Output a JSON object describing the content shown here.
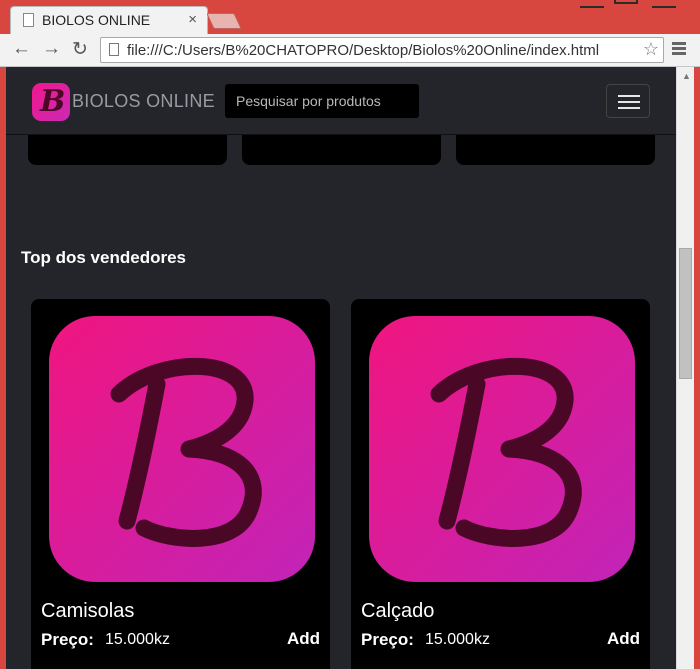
{
  "browser": {
    "tab_title": "BIOLOS ONLINE",
    "tab_close": "×",
    "url": "file:///C:/Users/B%20CHATOPRO/Desktop/Biolos%20Online/index.html",
    "icons": {
      "back": "←",
      "forward": "→",
      "reload": "↻",
      "star": "☆",
      "scroll_up": "▲"
    }
  },
  "navbar": {
    "logo_letter": "B",
    "brand": "BIOLOS ONLINE",
    "search_placeholder": "Pesquisar por produtos"
  },
  "section": {
    "title": "Top dos vendedores"
  },
  "products": [
    {
      "name": "Camisolas",
      "price_label": "Preço:",
      "price": "15.000kz",
      "add_label": "Add"
    },
    {
      "name": "Calçado",
      "price_label": "Preço:",
      "price": "15.000kz",
      "add_label": "Add"
    }
  ],
  "colors": {
    "brand_pink": "#f0157f",
    "brand_purple": "#c124b8",
    "page_bg": "#24242b",
    "card_bg": "#000000"
  }
}
